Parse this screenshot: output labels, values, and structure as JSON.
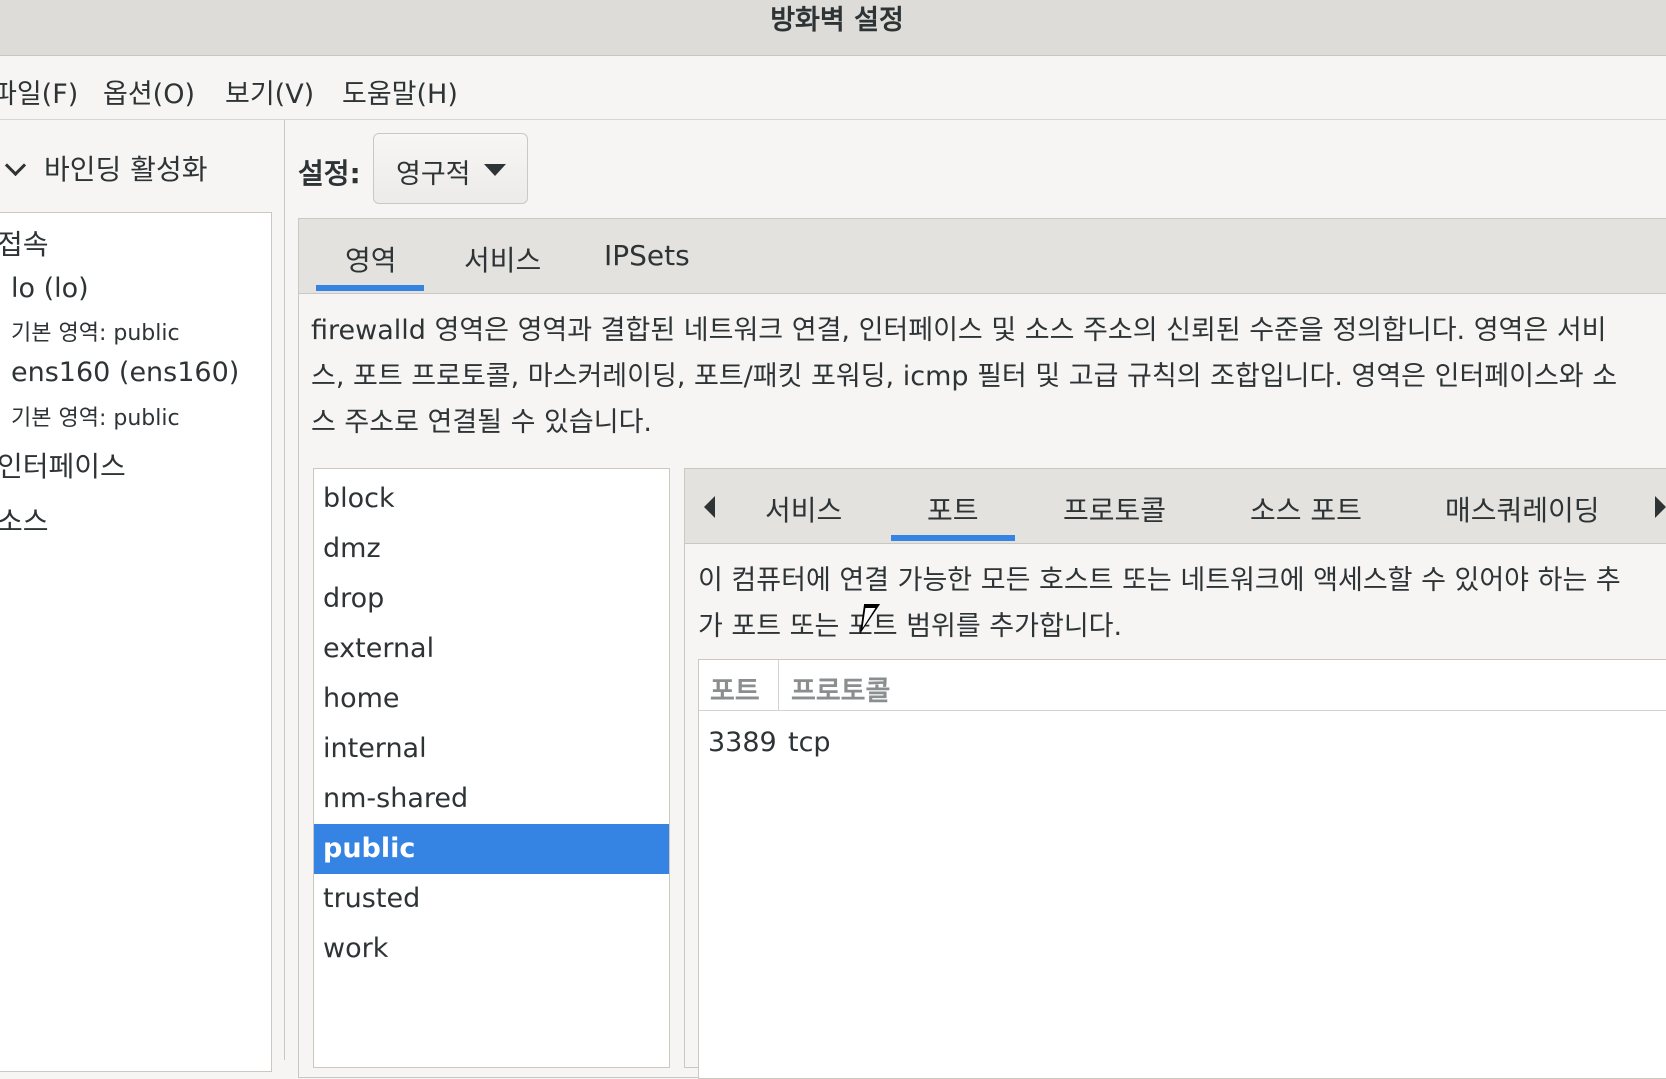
{
  "window": {
    "title": "방화벽 설정"
  },
  "menubar": {
    "file": "파일(F)",
    "options": "옵션(O)",
    "view": "보기(V)",
    "help": "도움말(H)"
  },
  "sidebar": {
    "binding_label": "바인딩 활성화",
    "connections_header": "접속",
    "connections": [
      {
        "name": "lo (lo)",
        "zone": "기본 영역: public"
      },
      {
        "name": "ens160 (ens160)",
        "zone": "기본 영역: public"
      }
    ],
    "interfaces_header": "인터페이스",
    "sources_header": "소스"
  },
  "config": {
    "label": "설정:",
    "value": "영구적"
  },
  "main_tabs": [
    "영역",
    "서비스",
    "IPSets"
  ],
  "zones_description": [
    "firewalld 영역은 영역과 결합된 네트워크 연결, 인터페이스 및 소스 주소의 신뢰된 수준을 정의합니다. 영역은 서비",
    "스, 포트 프로토콜, 마스커레이딩, 포트/패킷 포워딩, icmp 필터 및 고급 규칙의 조합입니다. 영역은 인터페이스와 소",
    "스 주소로 연결될 수 있습니다."
  ],
  "zones": [
    "block",
    "dmz",
    "drop",
    "external",
    "home",
    "internal",
    "nm-shared",
    "public",
    "trusted",
    "work"
  ],
  "selected_zone": "public",
  "zone_tabs": [
    "서비스",
    "포트",
    "프로토콜",
    "소스 포트",
    "매스쿼레이딩"
  ],
  "active_zone_tab": "포트",
  "ports_description": [
    "이 컴퓨터에 연결 가능한 모든 호스트 또는 네트워크에 액세스할 수 있어야 하는 추",
    "가 포트 또는 포트 범위를 추가합니다."
  ],
  "ports_table": {
    "columns": [
      "포트",
      "프로토콜"
    ],
    "rows": [
      {
        "port": "3389",
        "protocol": "tcp"
      }
    ]
  },
  "colors": {
    "accent": "#3584e4",
    "window_bg": "#f6f5f4"
  }
}
